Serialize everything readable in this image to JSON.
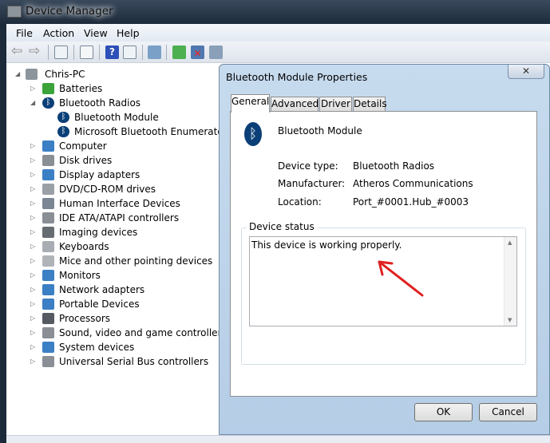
{
  "window": {
    "title": "Device Manager"
  },
  "menu": [
    "File",
    "Action",
    "View",
    "Help"
  ],
  "toolbar": [
    "back",
    "forward",
    "show-hide-console-tree",
    "properties",
    "help",
    "show-hide-action-pane",
    "scan-hardware-changes",
    "update-driver",
    "uninstall",
    "disable"
  ],
  "tree": {
    "root": "Chris-PC",
    "items": [
      {
        "label": "Batteries",
        "level": 1,
        "expander": "▷",
        "icon": "battery",
        "color": "#3aa33a"
      },
      {
        "label": "Bluetooth Radios",
        "level": 1,
        "expander": "◢",
        "icon": "bluetooth",
        "color": "#0b3f77"
      },
      {
        "label": "Bluetooth Module",
        "level": 2,
        "expander": "",
        "icon": "bluetooth",
        "color": "#0b3f77"
      },
      {
        "label": "Microsoft Bluetooth Enumerator",
        "level": 2,
        "expander": "",
        "icon": "bluetooth",
        "color": "#0b3f77"
      },
      {
        "label": "Computer",
        "level": 1,
        "expander": "▷",
        "icon": "computer",
        "color": "#3b7fc4"
      },
      {
        "label": "Disk drives",
        "level": 1,
        "expander": "▷",
        "icon": "disk",
        "color": "#8a8f95"
      },
      {
        "label": "Display adapters",
        "level": 1,
        "expander": "▷",
        "icon": "display",
        "color": "#3b7fc4"
      },
      {
        "label": "DVD/CD-ROM drives",
        "level": 1,
        "expander": "▷",
        "icon": "dvd",
        "color": "#9aa0a6"
      },
      {
        "label": "Human Interface Devices",
        "level": 1,
        "expander": "▷",
        "icon": "hid",
        "color": "#7a8694"
      },
      {
        "label": "IDE ATA/ATAPI controllers",
        "level": 1,
        "expander": "▷",
        "icon": "ide",
        "color": "#8a8f95"
      },
      {
        "label": "Imaging devices",
        "level": 1,
        "expander": "▷",
        "icon": "camera",
        "color": "#666c72"
      },
      {
        "label": "Keyboards",
        "level": 1,
        "expander": "▷",
        "icon": "keyboard",
        "color": "#a7adb3"
      },
      {
        "label": "Mice and other pointing devices",
        "level": 1,
        "expander": "▷",
        "icon": "mouse",
        "color": "#b0b4b8"
      },
      {
        "label": "Monitors",
        "level": 1,
        "expander": "▷",
        "icon": "monitor",
        "color": "#3b7fc4"
      },
      {
        "label": "Network adapters",
        "level": 1,
        "expander": "▷",
        "icon": "network",
        "color": "#3b7fc4"
      },
      {
        "label": "Portable Devices",
        "level": 1,
        "expander": "▷",
        "icon": "portable",
        "color": "#3b7fc4"
      },
      {
        "label": "Processors",
        "level": 1,
        "expander": "▷",
        "icon": "processor",
        "color": "#555a60"
      },
      {
        "label": "Sound, video and game controllers",
        "level": 1,
        "expander": "▷",
        "icon": "sound",
        "color": "#8a8f95"
      },
      {
        "label": "System devices",
        "level": 1,
        "expander": "▷",
        "icon": "system",
        "color": "#3b7fc4"
      },
      {
        "label": "Universal Serial Bus controllers",
        "level": 1,
        "expander": "▷",
        "icon": "usb",
        "color": "#8a8f95"
      }
    ]
  },
  "dialog": {
    "title": "Bluetooth Module Properties",
    "close": "✕",
    "tabs": [
      "General",
      "Advanced",
      "Driver",
      "Details"
    ],
    "device_name": "Bluetooth Module",
    "props": [
      {
        "label": "Device type:",
        "value": "Bluetooth Radios"
      },
      {
        "label": "Manufacturer:",
        "value": "Atheros Communications"
      },
      {
        "label": "Location:",
        "value": "Port_#0001.Hub_#0003"
      }
    ],
    "status_group": "Device status",
    "status_text": "This device is working properly.",
    "ok": "OK",
    "cancel": "Cancel"
  }
}
